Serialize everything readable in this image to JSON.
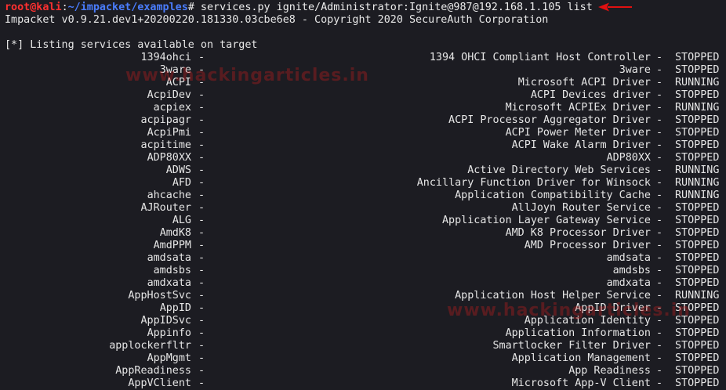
{
  "prompt": {
    "user_host": "root@kali",
    "sep": ":",
    "path": "~/impacket/examples",
    "symbol": "#",
    "command": " services.py ignite/Administrator:Ignite@987@192.168.1.105 list"
  },
  "banner": "Impacket v0.9.21.dev1+20200220.181330.03cbe6e8 - Copyright 2020 SecureAuth Corporation",
  "listing_header": "[*] Listing services available on target",
  "watermark": "www.hackingarticles.in",
  "arrow_color": "#e01010",
  "services": [
    {
      "name": "1394ohci",
      "display": "1394 OHCI Compliant Host Controller",
      "state": "STOPPED"
    },
    {
      "name": "3ware",
      "display": "3ware",
      "state": "STOPPED"
    },
    {
      "name": "ACPI",
      "display": "Microsoft ACPI Driver",
      "state": "RUNNING"
    },
    {
      "name": "AcpiDev",
      "display": "ACPI Devices driver",
      "state": "STOPPED"
    },
    {
      "name": "acpiex",
      "display": "Microsoft ACPIEx Driver",
      "state": "RUNNING"
    },
    {
      "name": "acpipagr",
      "display": "ACPI Processor Aggregator Driver",
      "state": "STOPPED"
    },
    {
      "name": "AcpiPmi",
      "display": "ACPI Power Meter Driver",
      "state": "STOPPED"
    },
    {
      "name": "acpitime",
      "display": "ACPI Wake Alarm Driver",
      "state": "STOPPED"
    },
    {
      "name": "ADP80XX",
      "display": "ADP80XX",
      "state": "STOPPED"
    },
    {
      "name": "ADWS",
      "display": "Active Directory Web Services",
      "state": "RUNNING"
    },
    {
      "name": "AFD",
      "display": "Ancillary Function Driver for Winsock",
      "state": "RUNNING"
    },
    {
      "name": "ahcache",
      "display": "Application Compatibility Cache",
      "state": "RUNNING"
    },
    {
      "name": "AJRouter",
      "display": "AllJoyn Router Service",
      "state": "STOPPED"
    },
    {
      "name": "ALG",
      "display": "Application Layer Gateway Service",
      "state": "STOPPED"
    },
    {
      "name": "AmdK8",
      "display": "AMD K8 Processor Driver",
      "state": "STOPPED"
    },
    {
      "name": "AmdPPM",
      "display": "AMD Processor Driver",
      "state": "STOPPED"
    },
    {
      "name": "amdsata",
      "display": "amdsata",
      "state": "STOPPED"
    },
    {
      "name": "amdsbs",
      "display": "amdsbs",
      "state": "STOPPED"
    },
    {
      "name": "amdxata",
      "display": "amdxata",
      "state": "STOPPED"
    },
    {
      "name": "AppHostSvc",
      "display": "Application Host Helper Service",
      "state": "RUNNING"
    },
    {
      "name": "AppID",
      "display": "AppID Driver",
      "state": "STOPPED"
    },
    {
      "name": "AppIDSvc",
      "display": "Application Identity",
      "state": "STOPPED"
    },
    {
      "name": "Appinfo",
      "display": "Application Information",
      "state": "STOPPED"
    },
    {
      "name": "applockerfltr",
      "display": "Smartlocker Filter Driver",
      "state": "STOPPED"
    },
    {
      "name": "AppMgmt",
      "display": "Application Management",
      "state": "STOPPED"
    },
    {
      "name": "AppReadiness",
      "display": "App Readiness",
      "state": "STOPPED"
    },
    {
      "name": "AppVClient",
      "display": "Microsoft App-V Client",
      "state": "STOPPED"
    }
  ]
}
